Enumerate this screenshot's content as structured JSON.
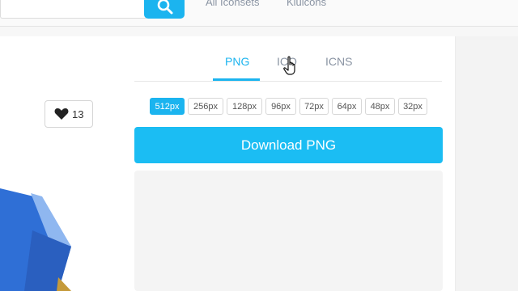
{
  "nav": {
    "links": [
      "All Iconsets",
      "Kiuicons"
    ]
  },
  "like": {
    "count": "13"
  },
  "tabs": [
    "PNG",
    "ICO",
    "ICNS"
  ],
  "active_tab": "PNG",
  "sizes": [
    "512px",
    "256px",
    "128px",
    "96px",
    "72px",
    "64px",
    "48px",
    "32px"
  ],
  "selected_size": "512px",
  "download": {
    "label": "Download PNG"
  },
  "colors": {
    "accent": "#1bb4ef",
    "button": "#1bbdf3",
    "icon_blue": "#2f6fd6"
  },
  "icons": [
    "search-icon",
    "heart-icon",
    "hand-pointer-cursor-icon"
  ]
}
